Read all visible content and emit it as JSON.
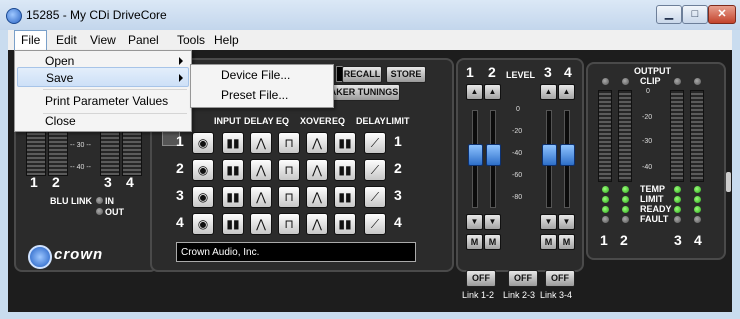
{
  "window": {
    "title": "15285 - My CDi DriveCore"
  },
  "caption_buttons": {
    "minimize": "▁",
    "maximize": "□",
    "close": "✕"
  },
  "menubar": [
    "File",
    "Edit",
    "View",
    "Panel",
    "Tools",
    "Help"
  ],
  "file_menu": {
    "items": [
      "Open",
      "Save",
      "Print Parameter Values",
      "Close"
    ],
    "highlighted": "Save"
  },
  "save_submenu": {
    "items": [
      "Device File...",
      "Preset File..."
    ]
  },
  "presets": {
    "recall": "RECALL",
    "store": "STORE",
    "speaker_tunings": "AKER TUNINGS"
  },
  "left_meters": {
    "channels": [
      "1",
      "2",
      "3",
      "4"
    ],
    "scale": [
      "-- 30 --",
      "-- 40 --"
    ],
    "blu_link": "BLU LINK",
    "in": "IN",
    "out": "OUT"
  },
  "brand": {
    "name": "crown"
  },
  "processing": {
    "headers": [
      "INPUT",
      "DELAY",
      "EQ",
      "XOVER",
      "EQ",
      "DELAY",
      "LIMIT"
    ],
    "channels": [
      "1",
      "2",
      "3",
      "4"
    ],
    "device_name": "Crown Audio, Inc."
  },
  "level": {
    "label": "LEVEL",
    "channels": [
      "1",
      "2",
      "3",
      "4"
    ],
    "scale": [
      "0",
      "-20",
      "-40",
      "-60",
      "-80"
    ],
    "mute": "M",
    "links": [
      {
        "button": "OFF",
        "label": "Link 1-2"
      },
      {
        "button": "OFF",
        "label": "Link 2-3"
      },
      {
        "button": "OFF",
        "label": "Link 3-4"
      }
    ]
  },
  "output": {
    "title": "OUTPUT",
    "clip": "CLIP",
    "scale": [
      "0",
      "-20",
      "-30",
      "-40"
    ],
    "status": [
      "TEMP",
      "LIMIT",
      "READY",
      "FAULT"
    ],
    "channels": [
      "1",
      "2",
      "3",
      "4"
    ]
  },
  "colors": {
    "led_green": "#2aa61b",
    "fader_blue": "#2e6fc9",
    "highlight": "#cde0f7"
  }
}
